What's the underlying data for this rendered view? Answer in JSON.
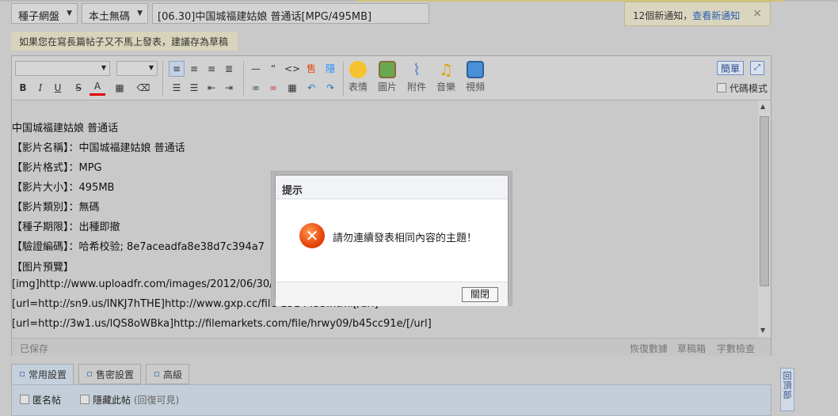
{
  "header": {
    "category_select": "種子網盤",
    "type_select": "本土無碼",
    "subject": "[06.30]中国城福建姑娘 普通话[MPG/495MB]"
  },
  "notification": {
    "text": "12個新通知，",
    "link": "查看新通知",
    "close": "×"
  },
  "draft_hint": "如果您在寫長篇帖子又不馬上發表，建議存為草稿",
  "toolbar": {
    "bold": "B",
    "italic": "I",
    "underline": "U",
    "strike": "S",
    "fontcolor": "A",
    "emoticon_label": "表情",
    "image_label": "圖片",
    "attach_label": "附件",
    "music_label": "音樂",
    "video_label": "視頻",
    "simple_label": "簡單",
    "code_mode_label": "代碼模式"
  },
  "content_lines": [
    "中国城福建姑娘 普通话",
    "【影片名稱】：中国城福建姑娘 普通话",
    "【影片格式】：MPG",
    "【影片大小】：495MB",
    "【影片類別】：無碼",
    "【種子期限】：出種即撤",
    "【驗證編碼】：哈希校验; 8e7aceadfa8e38d7c394a7",
    "【图片預覽】",
    "[img]http://www.uploadfr.com/images/2012/06/30/KW",
    "[url=http://sn9.us/lNKJ7hTHE]http://www.gxp.cc/file-1514453.html[/url]",
    "[url=http://3w1.us/lQS8oWBka]http://filemarkets.com/file/hrwy09/b45cc91e/[/url]"
  ],
  "statusbar": {
    "saved": "已保存",
    "restore": "恢復數據",
    "drafts": "草稿箱",
    "wordcheck": "字數檢查"
  },
  "tabs": [
    {
      "label": "常用設置"
    },
    {
      "label": "售密設置"
    },
    {
      "label": "高級"
    }
  ],
  "options": {
    "anonymous": "匿名帖",
    "hide": "隱藏此帖",
    "hide_hint": "(回復可見)"
  },
  "back_to_top": "回頂部",
  "dialog": {
    "title": "提示",
    "message": "請勿連續發表相同內容的主題！",
    "close_button": "關閉"
  }
}
